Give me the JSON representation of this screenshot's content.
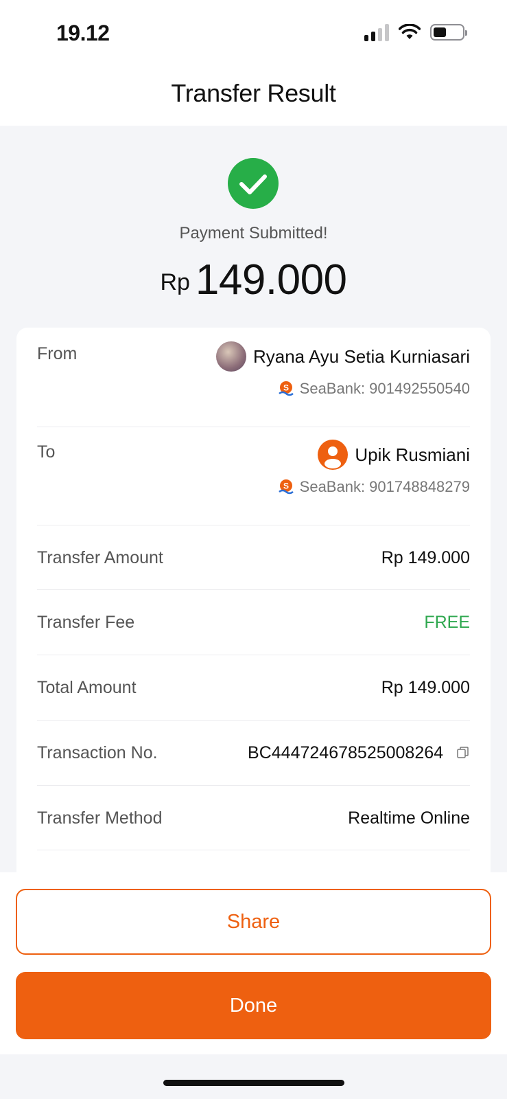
{
  "status_bar": {
    "time": "19.12"
  },
  "header": {
    "title": "Transfer Result"
  },
  "result": {
    "message": "Payment Submitted!",
    "currency": "Rp",
    "amount": "149.000",
    "icon": "check-circle-icon"
  },
  "details": {
    "from": {
      "label": "From",
      "name": "Ryana Ayu Setia Kurniasari",
      "bank": "SeaBank: 901492550540"
    },
    "to": {
      "label": "To",
      "name": "Upik Rusmiani",
      "bank": "SeaBank: 901748848279"
    },
    "rows": [
      {
        "label": "Transfer Amount",
        "value": "Rp 149.000"
      },
      {
        "label": "Transfer Fee",
        "value": "FREE"
      },
      {
        "label": "Total Amount",
        "value": "Rp 149.000"
      },
      {
        "label": "Transaction No.",
        "value": "BC444724678525008264"
      },
      {
        "label": "Transfer Method",
        "value": "Realtime Online"
      }
    ]
  },
  "actions": {
    "share_label": "Share",
    "done_label": "Done"
  },
  "colors": {
    "accent": "#ee6010",
    "success": "#27ae48",
    "free_text": "#2fa84f",
    "page_background": "#f4f5f8"
  }
}
